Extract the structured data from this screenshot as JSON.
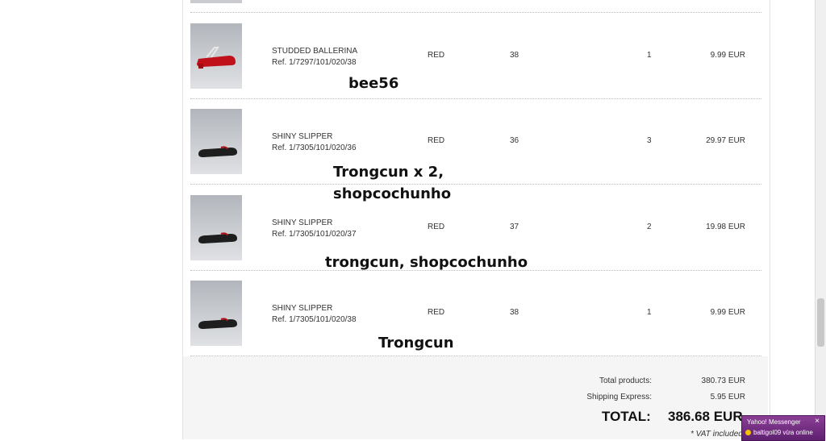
{
  "items": [
    {
      "name": "STUDDED BALLERINA",
      "ref": "Ref. 1/7297/101/020/38",
      "color": "RED",
      "size": "38",
      "qty": "1",
      "price": "9.99 EUR",
      "shoe_color": "#c0111b"
    },
    {
      "name": "SHINY SLIPPER",
      "ref": "Ref. 1/7305/101/020/36",
      "color": "RED",
      "size": "36",
      "qty": "3",
      "price": "29.97 EUR",
      "shoe_color": "#1e1e1e"
    },
    {
      "name": "SHINY SLIPPER",
      "ref": "Ref. 1/7305/101/020/37",
      "color": "RED",
      "size": "37",
      "qty": "2",
      "price": "19.98 EUR",
      "shoe_color": "#1e1e1e"
    },
    {
      "name": "SHINY SLIPPER",
      "ref": "Ref. 1/7305/101/020/38",
      "color": "RED",
      "size": "38",
      "qty": "1",
      "price": "9.99 EUR",
      "shoe_color": "#1e1e1e"
    }
  ],
  "annotations": {
    "a1": "bee56",
    "a2_line1": "Trongcun x 2,",
    "a2_line2": "shopcochunho",
    "a3": "trongcun, shopcochunho",
    "a4": "Trongcun"
  },
  "summary": {
    "total_products_label": "Total products:",
    "total_products_value": "380.73 EUR",
    "shipping_label": "Shipping  Express:",
    "shipping_value": "5.95 EUR",
    "total_label": "TOTAL:",
    "total_value": "386.68 EUR",
    "vat_note": "* VAT included"
  },
  "messenger": {
    "title": "Yahoo! Messenger",
    "close": "×",
    "message": "baltigol09 vừa online"
  }
}
